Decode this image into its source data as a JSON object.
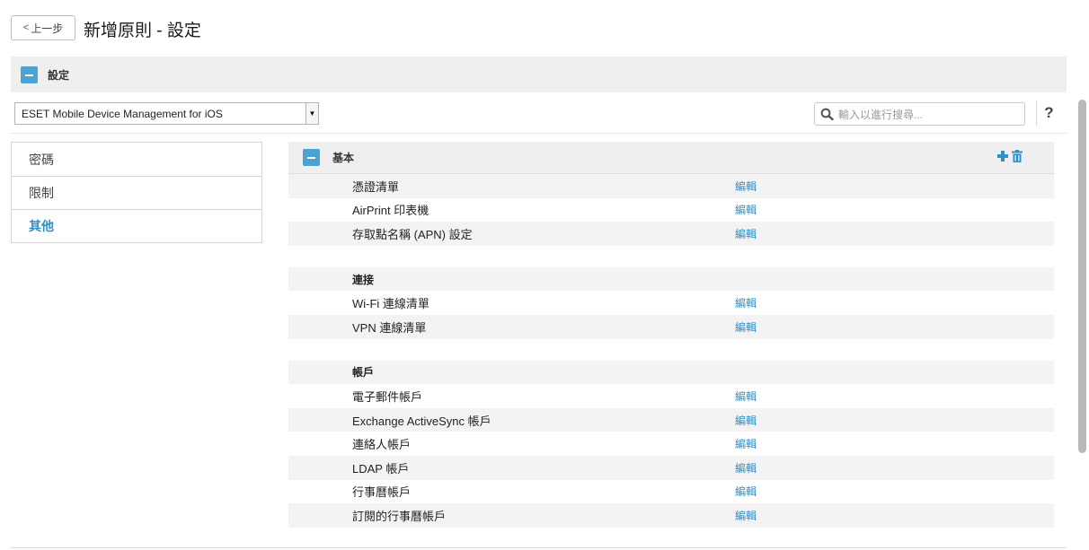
{
  "header": {
    "back_label": "上一步",
    "title": "新增原則 - 設定"
  },
  "section": {
    "label": "設定"
  },
  "product_select": {
    "value": "ESET Mobile Device Management for iOS"
  },
  "search": {
    "placeholder": "輸入以進行搜尋..."
  },
  "help_label": "?",
  "nav": {
    "items": [
      {
        "label": "密碼"
      },
      {
        "label": "限制"
      },
      {
        "label": "其他"
      }
    ],
    "active": "其他"
  },
  "group": {
    "label": "基本"
  },
  "edit_label": "編輯",
  "settings": {
    "basic": [
      {
        "name": "憑證清單"
      },
      {
        "name": "AirPrint 印表機"
      },
      {
        "name": "存取點名稱 (APN) 設定"
      }
    ],
    "connection_title": "連接",
    "connection": [
      {
        "name": "Wi-Fi 連線清單"
      },
      {
        "name": "VPN 連線清單"
      }
    ],
    "accounts_title": "帳戶",
    "accounts": [
      {
        "name": "電子郵件帳戶"
      },
      {
        "name": "Exchange ActiveSync 帳戶"
      },
      {
        "name": "連絡人帳戶"
      },
      {
        "name": "LDAP 帳戶"
      },
      {
        "name": "行事曆帳戶"
      },
      {
        "name": "訂閱的行事曆帳戶"
      }
    ]
  },
  "colors": {
    "accent": "#2f8fc7",
    "collapse_box": "#4aa3d1",
    "header_bg": "#efefef"
  }
}
